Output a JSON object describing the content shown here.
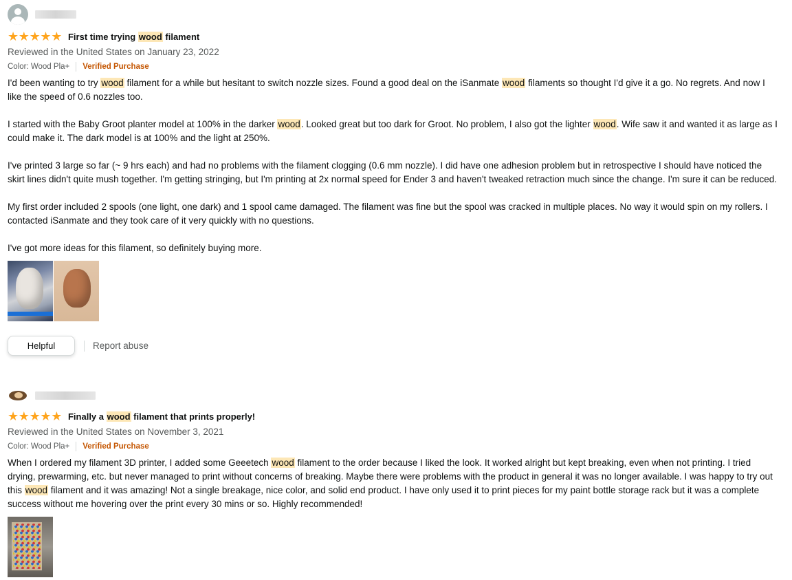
{
  "reviews": [
    {
      "stars": 5,
      "title_before": "First time trying ",
      "title_highlight": "wood",
      "title_after": " filament",
      "date": "Reviewed in the United States on January 23, 2022",
      "color": "Color: Wood Pla+",
      "verified": "Verified Purchase",
      "paragraphs": [
        [
          "I'd been wanting to try ",
          "wood",
          " filament for a while but hesitant to switch nozzle sizes. Found a good deal on the iSanmate ",
          "wood",
          " filaments so thought I'd give it a go. No regrets. And now I like the speed of 0.6 nozzles too."
        ],
        [
          "I started with the Baby Groot planter model at 100% in the darker ",
          "wood",
          ". Looked great but too dark for Groot. No problem, I also got the lighter ",
          "wood",
          ". Wife saw it and wanted it as large as I could make it. The dark model is at 100% and the light at 250%."
        ],
        [
          "I've printed 3 large so far (~ 9 hrs each) and had no problems with the filament clogging (0.6 mm nozzle). I did have one adhesion problem but in retrospective I should have noticed the skirt lines didn't quite mush together. I'm getting stringing, but I'm printing at 2x normal speed for Ender 3 and haven't tweaked retraction much since the change. I'm sure it can be reduced."
        ],
        [
          "My first order included 2 spools (one light, one dark) and 1 spool came damaged. The filament was fine but the spool was cracked in multiple places. No way it would spin on my rollers. I contacted iSanmate and they took care of it very quickly with no questions."
        ],
        [
          "I've got more ideas for this filament, so definitely buying more."
        ]
      ],
      "helpful_label": "Helpful",
      "report_label": "Report abuse"
    },
    {
      "stars": 5,
      "title_before": "Finally a ",
      "title_highlight": "wood",
      "title_after": " filament that prints properly!",
      "date": "Reviewed in the United States on November 3, 2021",
      "color": "Color: Wood Pla+",
      "verified": "Verified Purchase",
      "paragraphs": [
        [
          "When I ordered my filament 3D printer, I added some Geeetech ",
          "wood",
          " filament to the order because I liked the look. It worked alright but kept breaking, even when not printing. I tried drying, prewarming, etc. but never managed to print without concerns of breaking. Maybe there were problems with the product in general it was no longer available. I was happy to try out this ",
          "wood",
          " filament and it was amazing! Not a single breakage, nice color, and solid end product. I have only used it to print pieces for my paint bottle storage rack but it was a complete success without me hovering over the print every 30 mins or so. Highly recommended!"
        ]
      ]
    }
  ],
  "icons": {
    "star": "★",
    "avatar_default": "user-silhouette-icon"
  },
  "colors": {
    "star": "#ffa41c",
    "highlight": "#fde7b6",
    "verified": "#c45500",
    "secondary_text": "#565959"
  }
}
